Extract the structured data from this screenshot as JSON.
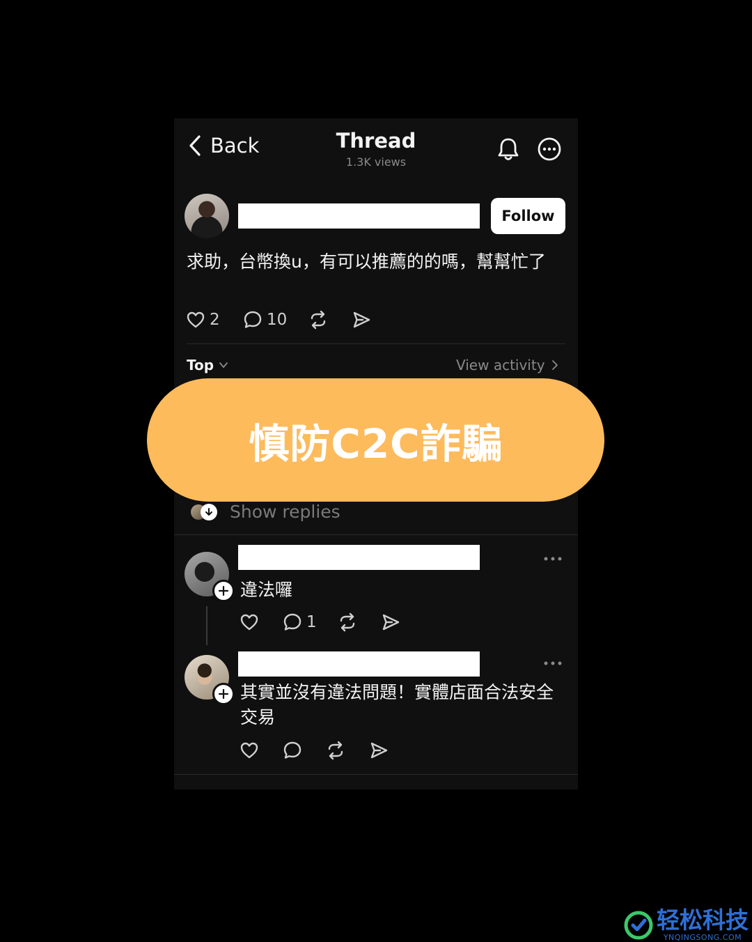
{
  "header": {
    "back_label": "Back",
    "title": "Thread",
    "views": "1.3K views"
  },
  "post": {
    "follow_label": "Follow",
    "text": "求助，台幣換u，有可以推薦的的嗎，幫幫忙了",
    "likes": "2",
    "comments": "10"
  },
  "sort": {
    "label": "Top",
    "activity_label": "View activity"
  },
  "banner": {
    "text": "慎防C2C詐騙",
    "color": "#fdbb5c"
  },
  "show_replies": {
    "label": "Show replies"
  },
  "replies": [
    {
      "text": "違法囉",
      "comments": "1"
    },
    {
      "text": "其實並沒有違法問題！實體店面合法安全交易",
      "comments": ""
    }
  ],
  "watermark": {
    "name": "轻松科技",
    "url": "YNQINGSONG.COM",
    "color": "#2f6fd6"
  }
}
